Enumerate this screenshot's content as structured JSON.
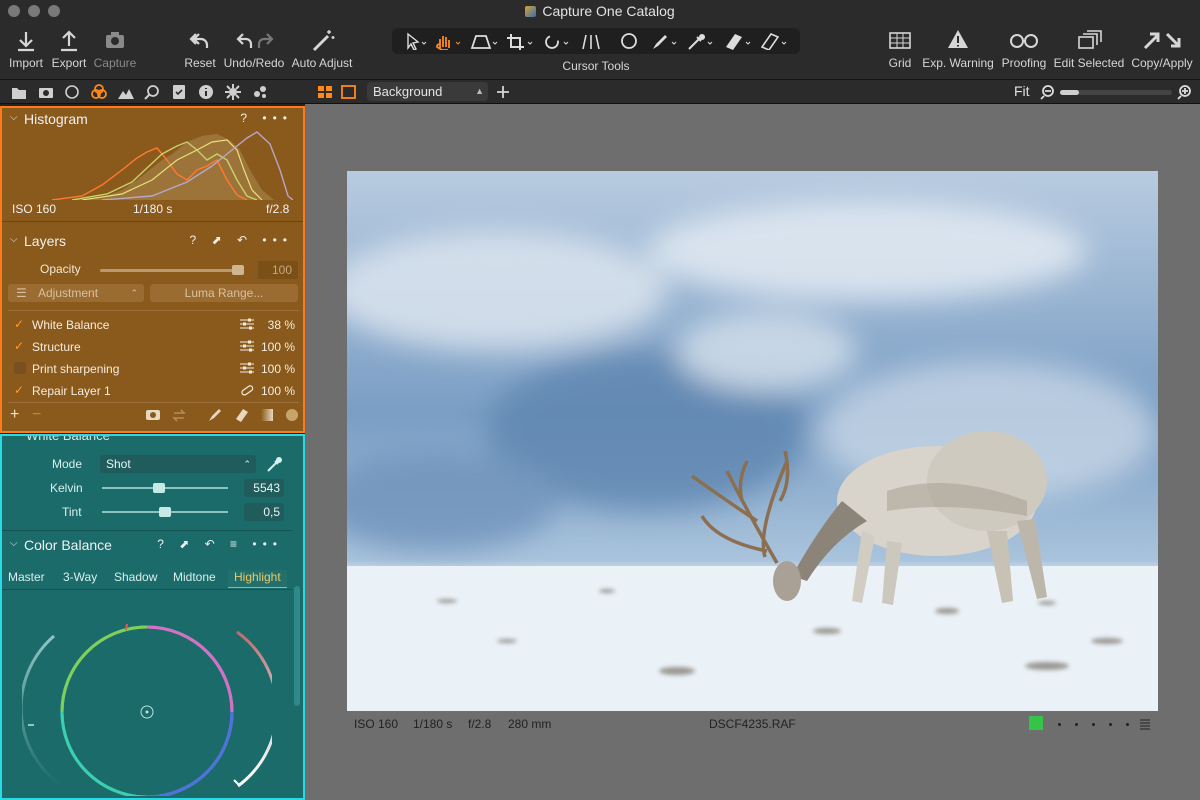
{
  "window": {
    "title": "Capture One Catalog"
  },
  "toolbar": {
    "import": "Import",
    "export": "Export",
    "capture": "Capture",
    "reset": "Reset",
    "undo_redo": "Undo/Redo",
    "auto_adjust": "Auto Adjust",
    "cursor_tools": "Cursor Tools",
    "grid": "Grid",
    "exp_warning": "Exp. Warning",
    "proofing": "Proofing",
    "edit_selected": "Edit Selected",
    "copy_apply": "Copy/Apply"
  },
  "viewer_bar": {
    "layer_select": "Background",
    "zoom_label": "Fit",
    "zoom_level": 0.12
  },
  "histogram": {
    "title": "Histogram",
    "help": "?",
    "more": "•••",
    "iso": "ISO 160",
    "shutter": "1/180 s",
    "aperture": "f/2.8"
  },
  "layers": {
    "title": "Layers",
    "help": "?",
    "more": "•••",
    "opacity_label": "Opacity",
    "opacity_value": "100",
    "opacity_level": 1.0,
    "adjustment_label": "Adjustment",
    "luma_range_label": "Luma Range...",
    "items": [
      {
        "name": "White Balance",
        "checked": true,
        "pct": "38 %"
      },
      {
        "name": "Structure",
        "checked": true,
        "pct": "100 %"
      },
      {
        "name": "Print sharpening",
        "checked": false,
        "pct": "100 %"
      },
      {
        "name": "Repair Layer 1",
        "checked": true,
        "pct": "100 %"
      }
    ],
    "add": "+",
    "remove": "−"
  },
  "white_balance": {
    "title": "White Balance",
    "mode_label": "Mode",
    "mode_value": "Shot",
    "kelvin_label": "Kelvin",
    "kelvin_value": "5543",
    "kelvin_level": 0.45,
    "tint_label": "Tint",
    "tint_value": "0,5",
    "tint_level": 0.5
  },
  "color_balance": {
    "title": "Color Balance",
    "help": "?",
    "more": "•••",
    "tabs": [
      "Master",
      "3-Way",
      "Shadow",
      "Midtone",
      "Highlight"
    ],
    "active_tab": "Highlight"
  },
  "image_info": {
    "iso": "ISO 160",
    "shutter": "1/180 s",
    "aperture": "f/2.8",
    "focal": "280 mm",
    "filename": "DSCF4235.RAF",
    "color_tag": "#35c44a",
    "rating": 0
  },
  "colors": {
    "accent_orange": "#ff7a1a",
    "accent_cyan": "#29d9e6"
  }
}
